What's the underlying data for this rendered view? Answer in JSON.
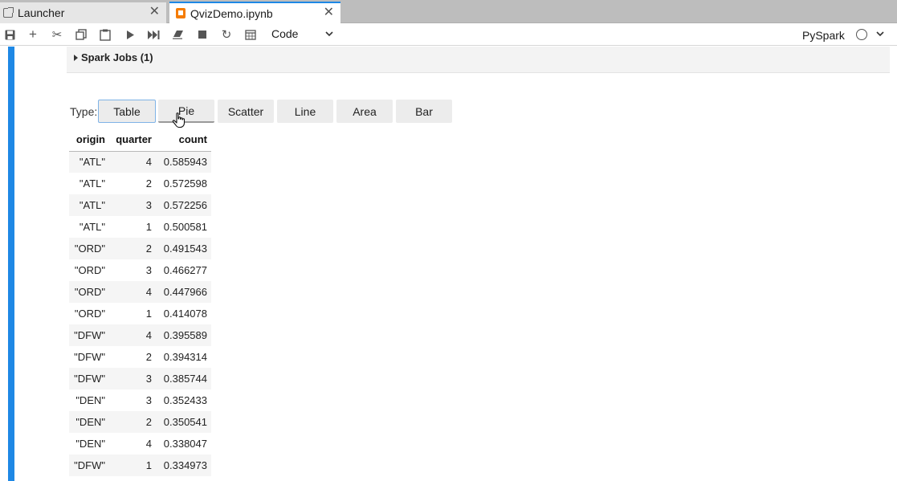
{
  "tabs": [
    {
      "label": "Launcher",
      "icon": "launcher-icon",
      "active": false
    },
    {
      "label": "QvizDemo.ipynb",
      "icon": "notebook-icon",
      "active": true
    }
  ],
  "toolbar": {
    "cell_type": "Code",
    "kernel_name": "PySpark"
  },
  "output": {
    "spark_jobs_label": "Spark Jobs (1)",
    "type_label": "Type:",
    "viz_types": [
      "Table",
      "Pie",
      "Scatter",
      "Line",
      "Area",
      "Bar"
    ],
    "selected_type": "Table"
  },
  "table": {
    "columns": [
      "origin",
      "quarter",
      "count"
    ],
    "rows": [
      [
        "\"ATL\"",
        "4",
        "0.585943"
      ],
      [
        "\"ATL\"",
        "2",
        "0.572598"
      ],
      [
        "\"ATL\"",
        "3",
        "0.572256"
      ],
      [
        "\"ATL\"",
        "1",
        "0.500581"
      ],
      [
        "\"ORD\"",
        "2",
        "0.491543"
      ],
      [
        "\"ORD\"",
        "3",
        "0.466277"
      ],
      [
        "\"ORD\"",
        "4",
        "0.447966"
      ],
      [
        "\"ORD\"",
        "1",
        "0.414078"
      ],
      [
        "\"DFW\"",
        "4",
        "0.395589"
      ],
      [
        "\"DFW\"",
        "2",
        "0.394314"
      ],
      [
        "\"DFW\"",
        "3",
        "0.385744"
      ],
      [
        "\"DEN\"",
        "3",
        "0.352433"
      ],
      [
        "\"DEN\"",
        "2",
        "0.350541"
      ],
      [
        "\"DEN\"",
        "4",
        "0.338047"
      ],
      [
        "\"DFW\"",
        "1",
        "0.334973"
      ]
    ]
  },
  "colors": {
    "accent": "#1e88e5",
    "tab_bar": "#bdbdbd",
    "notebook_icon": "#f57c00"
  }
}
